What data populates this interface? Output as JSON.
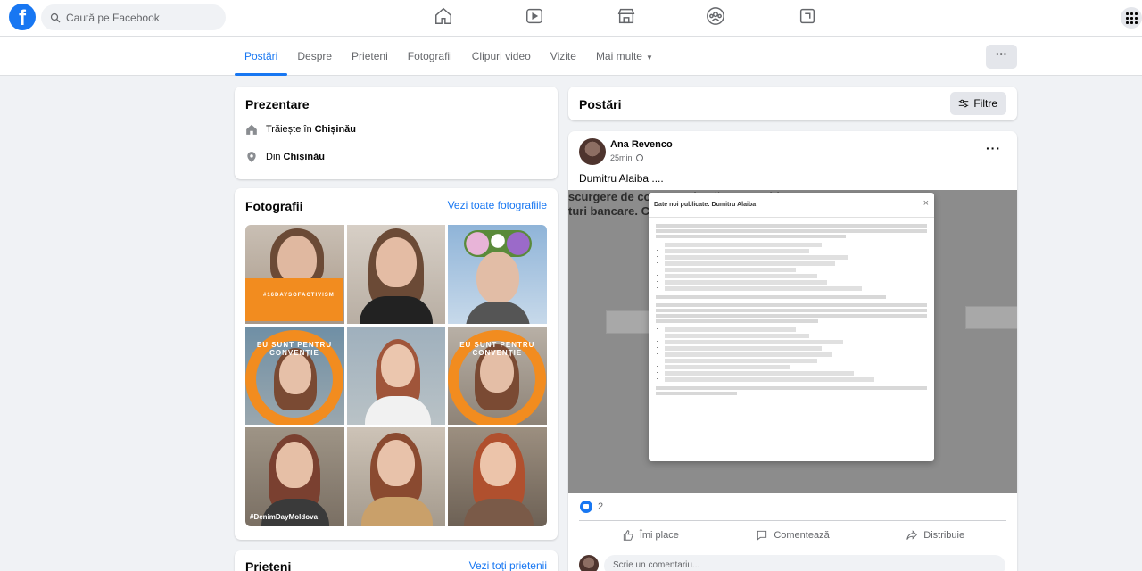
{
  "search": {
    "placeholder": "Caută pe Facebook"
  },
  "brand": {
    "color": "#1877f2",
    "logo_letter": "f"
  },
  "nav_icons": [
    "home-icon",
    "video-icon",
    "marketplace-icon",
    "groups-icon",
    "gaming-icon"
  ],
  "tabs": [
    {
      "label": "Postări",
      "active": true
    },
    {
      "label": "Despre"
    },
    {
      "label": "Prieteni"
    },
    {
      "label": "Fotografii"
    },
    {
      "label": "Clipuri video"
    },
    {
      "label": "Vizite"
    },
    {
      "label": "Mai multe"
    }
  ],
  "more_button": "···",
  "intro": {
    "title": "Prezentare",
    "lives_prefix": "Trăiește în",
    "lives_city": "Chișinău",
    "from_prefix": "Din",
    "from_city": "Chișinău"
  },
  "photos": {
    "title": "Fotografii",
    "see_all": "Vezi toate fotografiile",
    "ring_text": "EU SUNT PENTRU CONVENȚIE",
    "ring_text_2": "EU SUNT PENTRU CONVENȚIE",
    "banner_text": "#16DAYSOFACTIVISM",
    "tag": "#DenimDayMoldova"
  },
  "friends": {
    "title": "Prieteni",
    "see_all": "Vezi toți prietenii"
  },
  "posts": {
    "title": "Postări",
    "filter": "Filtre"
  },
  "post": {
    "author": "Ana Revenco",
    "time": "25min",
    "text": "Dumitru Alaiba ....",
    "bg_line_1": "scurgere de corespondență ... ca Moldova. Mes",
    "bg_line_2": "turi bancare. Ce... Citește aici https",
    "reactions_count": "2",
    "like": "Îmi place",
    "comment": "Comentează",
    "share": "Distribuie",
    "comment_placeholder": "Scrie un comentariu..."
  },
  "modal": {
    "title": "Date noi publicate: Dumitru Alaiba",
    "close": "×"
  }
}
